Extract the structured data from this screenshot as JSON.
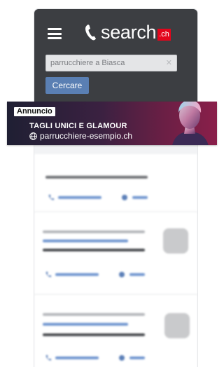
{
  "header": {
    "logo_text": "search",
    "logo_tld": ".ch",
    "brand_color": "#e3051b",
    "background_color": "#3c3e42"
  },
  "search": {
    "value": "parrucchiere a Biasca",
    "clear_symbol": "✕",
    "button_label": "Cercare"
  },
  "ad": {
    "badge": "Annuncio",
    "headline": "TAGLI UNICI E GLAMOUR",
    "url": "parrucchiere-esempio.ch"
  },
  "icons": {
    "menu": "hamburger-menu-icon",
    "logo": "phone-handset-icon",
    "clear": "close-icon",
    "globe": "globe-icon",
    "phone": "phone-icon",
    "web": "globe-icon"
  }
}
